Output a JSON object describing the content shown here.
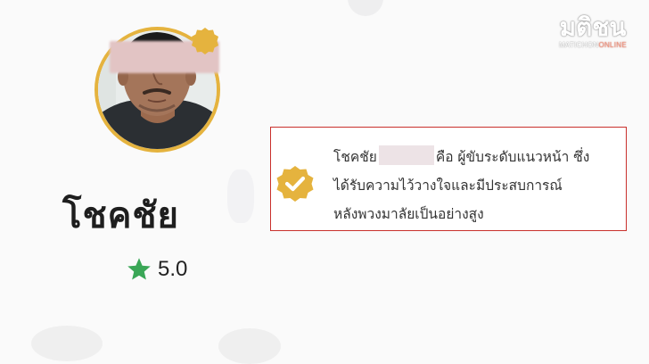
{
  "profile": {
    "name": "โชคชัย",
    "rating": "5.0"
  },
  "info": {
    "line1_start": "โชคชัย",
    "line1_end": "คือ ผู้ขับระดับแนวหน้า ซึ่ง",
    "line2": "ได้รับความไว้วางใจและมีประสบการณ์",
    "line3": "หลังพวงมาลัยเป็นอย่างสูง"
  },
  "watermark": {
    "logo": "มติชน",
    "sub_main": "MATICHON",
    "sub_accent": "ONLINE"
  },
  "icons": {
    "avatar_badge": "verified-badge-icon",
    "info_icon": "verified-check-icon",
    "rating_icon": "star-icon"
  },
  "colors": {
    "accent_gold": "#e5b33e",
    "star_green": "#3aa757",
    "highlight_border": "#c9302c"
  }
}
